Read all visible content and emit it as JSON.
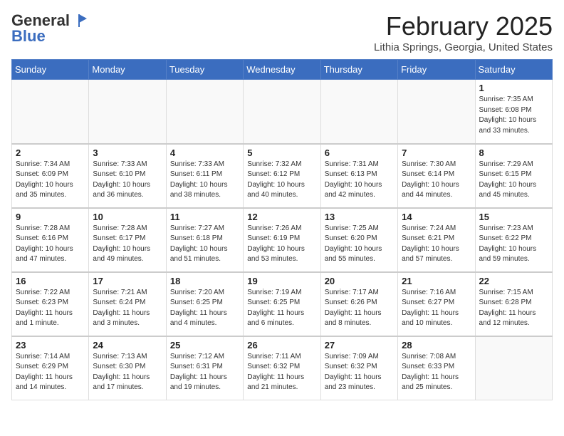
{
  "header": {
    "logo_general": "General",
    "logo_blue": "Blue",
    "month_title": "February 2025",
    "location": "Lithia Springs, Georgia, United States"
  },
  "days_of_week": [
    "Sunday",
    "Monday",
    "Tuesday",
    "Wednesday",
    "Thursday",
    "Friday",
    "Saturday"
  ],
  "weeks": [
    [
      {
        "day": "",
        "info": ""
      },
      {
        "day": "",
        "info": ""
      },
      {
        "day": "",
        "info": ""
      },
      {
        "day": "",
        "info": ""
      },
      {
        "day": "",
        "info": ""
      },
      {
        "day": "",
        "info": ""
      },
      {
        "day": "1",
        "info": "Sunrise: 7:35 AM\nSunset: 6:08 PM\nDaylight: 10 hours\nand 33 minutes."
      }
    ],
    [
      {
        "day": "2",
        "info": "Sunrise: 7:34 AM\nSunset: 6:09 PM\nDaylight: 10 hours\nand 35 minutes."
      },
      {
        "day": "3",
        "info": "Sunrise: 7:33 AM\nSunset: 6:10 PM\nDaylight: 10 hours\nand 36 minutes."
      },
      {
        "day": "4",
        "info": "Sunrise: 7:33 AM\nSunset: 6:11 PM\nDaylight: 10 hours\nand 38 minutes."
      },
      {
        "day": "5",
        "info": "Sunrise: 7:32 AM\nSunset: 6:12 PM\nDaylight: 10 hours\nand 40 minutes."
      },
      {
        "day": "6",
        "info": "Sunrise: 7:31 AM\nSunset: 6:13 PM\nDaylight: 10 hours\nand 42 minutes."
      },
      {
        "day": "7",
        "info": "Sunrise: 7:30 AM\nSunset: 6:14 PM\nDaylight: 10 hours\nand 44 minutes."
      },
      {
        "day": "8",
        "info": "Sunrise: 7:29 AM\nSunset: 6:15 PM\nDaylight: 10 hours\nand 45 minutes."
      }
    ],
    [
      {
        "day": "9",
        "info": "Sunrise: 7:28 AM\nSunset: 6:16 PM\nDaylight: 10 hours\nand 47 minutes."
      },
      {
        "day": "10",
        "info": "Sunrise: 7:28 AM\nSunset: 6:17 PM\nDaylight: 10 hours\nand 49 minutes."
      },
      {
        "day": "11",
        "info": "Sunrise: 7:27 AM\nSunset: 6:18 PM\nDaylight: 10 hours\nand 51 minutes."
      },
      {
        "day": "12",
        "info": "Sunrise: 7:26 AM\nSunset: 6:19 PM\nDaylight: 10 hours\nand 53 minutes."
      },
      {
        "day": "13",
        "info": "Sunrise: 7:25 AM\nSunset: 6:20 PM\nDaylight: 10 hours\nand 55 minutes."
      },
      {
        "day": "14",
        "info": "Sunrise: 7:24 AM\nSunset: 6:21 PM\nDaylight: 10 hours\nand 57 minutes."
      },
      {
        "day": "15",
        "info": "Sunrise: 7:23 AM\nSunset: 6:22 PM\nDaylight: 10 hours\nand 59 minutes."
      }
    ],
    [
      {
        "day": "16",
        "info": "Sunrise: 7:22 AM\nSunset: 6:23 PM\nDaylight: 11 hours\nand 1 minute."
      },
      {
        "day": "17",
        "info": "Sunrise: 7:21 AM\nSunset: 6:24 PM\nDaylight: 11 hours\nand 3 minutes."
      },
      {
        "day": "18",
        "info": "Sunrise: 7:20 AM\nSunset: 6:25 PM\nDaylight: 11 hours\nand 4 minutes."
      },
      {
        "day": "19",
        "info": "Sunrise: 7:19 AM\nSunset: 6:25 PM\nDaylight: 11 hours\nand 6 minutes."
      },
      {
        "day": "20",
        "info": "Sunrise: 7:17 AM\nSunset: 6:26 PM\nDaylight: 11 hours\nand 8 minutes."
      },
      {
        "day": "21",
        "info": "Sunrise: 7:16 AM\nSunset: 6:27 PM\nDaylight: 11 hours\nand 10 minutes."
      },
      {
        "day": "22",
        "info": "Sunrise: 7:15 AM\nSunset: 6:28 PM\nDaylight: 11 hours\nand 12 minutes."
      }
    ],
    [
      {
        "day": "23",
        "info": "Sunrise: 7:14 AM\nSunset: 6:29 PM\nDaylight: 11 hours\nand 14 minutes."
      },
      {
        "day": "24",
        "info": "Sunrise: 7:13 AM\nSunset: 6:30 PM\nDaylight: 11 hours\nand 17 minutes."
      },
      {
        "day": "25",
        "info": "Sunrise: 7:12 AM\nSunset: 6:31 PM\nDaylight: 11 hours\nand 19 minutes."
      },
      {
        "day": "26",
        "info": "Sunrise: 7:11 AM\nSunset: 6:32 PM\nDaylight: 11 hours\nand 21 minutes."
      },
      {
        "day": "27",
        "info": "Sunrise: 7:09 AM\nSunset: 6:32 PM\nDaylight: 11 hours\nand 23 minutes."
      },
      {
        "day": "28",
        "info": "Sunrise: 7:08 AM\nSunset: 6:33 PM\nDaylight: 11 hours\nand 25 minutes."
      },
      {
        "day": "",
        "info": ""
      }
    ]
  ]
}
